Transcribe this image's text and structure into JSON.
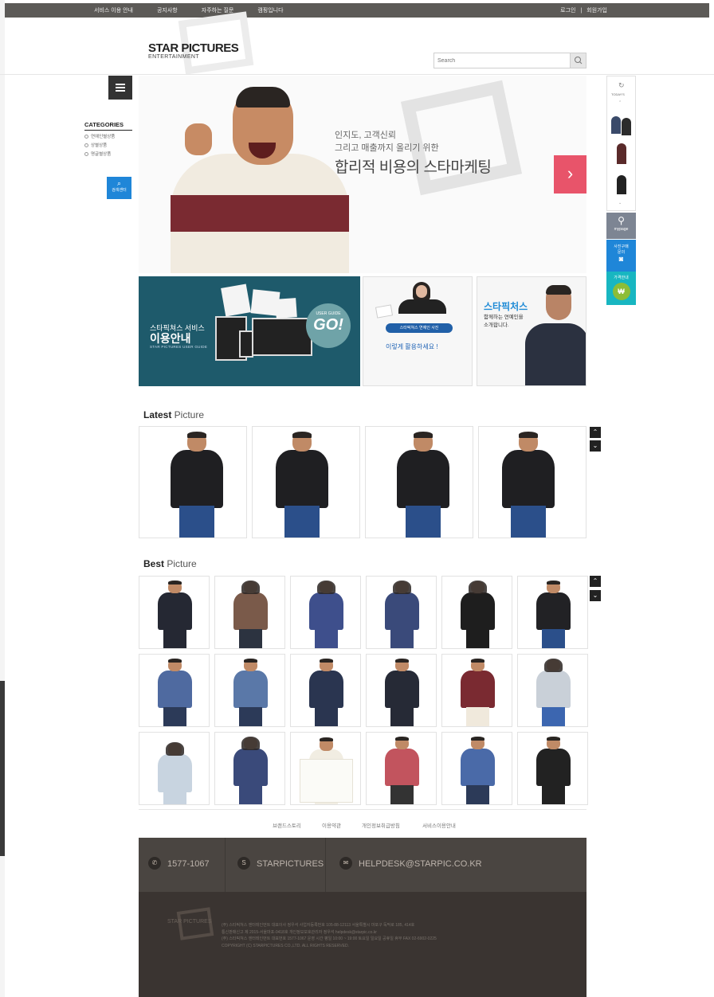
{
  "topnav": {
    "links": [
      "서비스 이용 안내",
      "공지사항",
      "자주하는 질문",
      "캠핑입니다"
    ],
    "login": "로그인",
    "separator": "|",
    "join": "회원가입"
  },
  "header": {
    "logo_main": "STAR PICTURES",
    "logo_sub": "ENTERTAINMENT",
    "search_placeholder": "Search"
  },
  "sidebar": {
    "categories_title": "CATEGORIES",
    "items": [
      "연예인별상품",
      "상별상품",
      "명글별상품"
    ],
    "cs_label": "검색센터"
  },
  "hero": {
    "line1": "인지도, 고객신뢰",
    "line2": "그리고 매출까지 올리기 위한",
    "headline": "합리적 비용의 스타마케팅",
    "next_icon": "›"
  },
  "promos": {
    "guide_line1": "스타픽쳐스 서비스",
    "guide_line2": "이용안내",
    "guide_line3": "STAR PICTURES USER GUIDE",
    "guide_badge_small": "USER GUIDE",
    "guide_badge_big": "GO!",
    "photo_pill": "스타픽쳐스 연예인 사진",
    "photo_sub": "이렇게 활용하세요 !",
    "star_title": "스타픽처스",
    "star_line1": "함께하는 연예인을",
    "star_line2": "소개합니다."
  },
  "sections": {
    "latest_bold": "Latest",
    "latest_rest": " Picture",
    "best_bold": "Best",
    "best_rest": " Picture",
    "up_arrow": "⌃",
    "down_arrow": "⌄"
  },
  "quickbar": {
    "today": "TODAY'S",
    "mypage": "mypage",
    "buy_line1": "사진구매",
    "buy_line2": "문의",
    "price": "가격안내",
    "won": "₩"
  },
  "footer": {
    "links": [
      "브랜드스토리",
      "이용약관",
      "개인정보취급방침",
      "서비스이용안내"
    ],
    "phone": "1577-1067",
    "brand": "STARPICTURES",
    "email": "HELPDESK@STARPIC.CO.KR",
    "company_logo": "STAR PICTURES",
    "info_line1": "(주) 스타픽쳐스 엔터테인먼트  대표이사 정우석  사업자등록번호 105-88-12113  서울특별시 마포구 독막로 185, 414호",
    "info_line2": "통신판매신고 제 2015-서울마포-0418호   개인정보보호관리자 정우석 helpdesk@starpic.co.kr",
    "info_line3": "(주) 스타픽쳐스 엔터테인먼트 대표번호 1577-1067   운영 시간 평일 10:00 ~ 19:00 토요일 일요일 공휴일 휴무  FAX 02-6902-0225",
    "info_line4": "COPYRIGHT (C) STARPICTURES CO.,LTD. ALL RIGHTS RESERVED."
  },
  "colors": {
    "topbar": "#5c5a57",
    "accent_red": "#e8546a",
    "accent_blue": "#1f86d8",
    "footer_dark": "#3a3431"
  }
}
